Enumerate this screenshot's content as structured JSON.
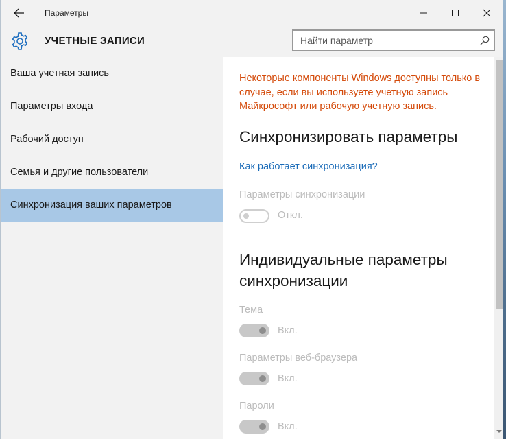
{
  "window": {
    "title": "Параметры"
  },
  "header": {
    "section_title": "УЧЕТНЫЕ ЗАПИСИ",
    "search_placeholder": "Найти параметр"
  },
  "sidebar": {
    "items": [
      {
        "label": "Ваша учетная запись"
      },
      {
        "label": "Параметры входа"
      },
      {
        "label": "Рабочий доступ"
      },
      {
        "label": "Семья и другие пользователи"
      },
      {
        "label": "Синхронизация ваших параметров",
        "selected": true
      }
    ]
  },
  "content": {
    "warning_text": "Некоторые компоненты Windows доступны только в случае, если вы используете учетную запись Майкрософт или рабочую учетную запись.",
    "sync_heading": "Синхронизировать параметры",
    "how_link": "Как работает синхронизация?",
    "sync_settings": {
      "label": "Параметры синхронизации",
      "state": "Откл.",
      "on": false
    },
    "individual_heading": "Индивидуальные параметры синхронизации",
    "items": [
      {
        "label": "Тема",
        "state": "Вкл.",
        "on": true
      },
      {
        "label": "Параметры веб-браузера",
        "state": "Вкл.",
        "on": true
      },
      {
        "label": "Пароли",
        "state": "Вкл.",
        "on": true
      }
    ]
  },
  "colors": {
    "accent_selected": "#a8c8e6",
    "warning": "#d44a0a",
    "link": "#1a6bb8"
  },
  "icons": {
    "back": "back-arrow-icon",
    "minimize": "minimize-icon",
    "maximize": "maximize-icon",
    "close": "close-icon",
    "settings": "gear-icon",
    "search": "search-icon"
  }
}
